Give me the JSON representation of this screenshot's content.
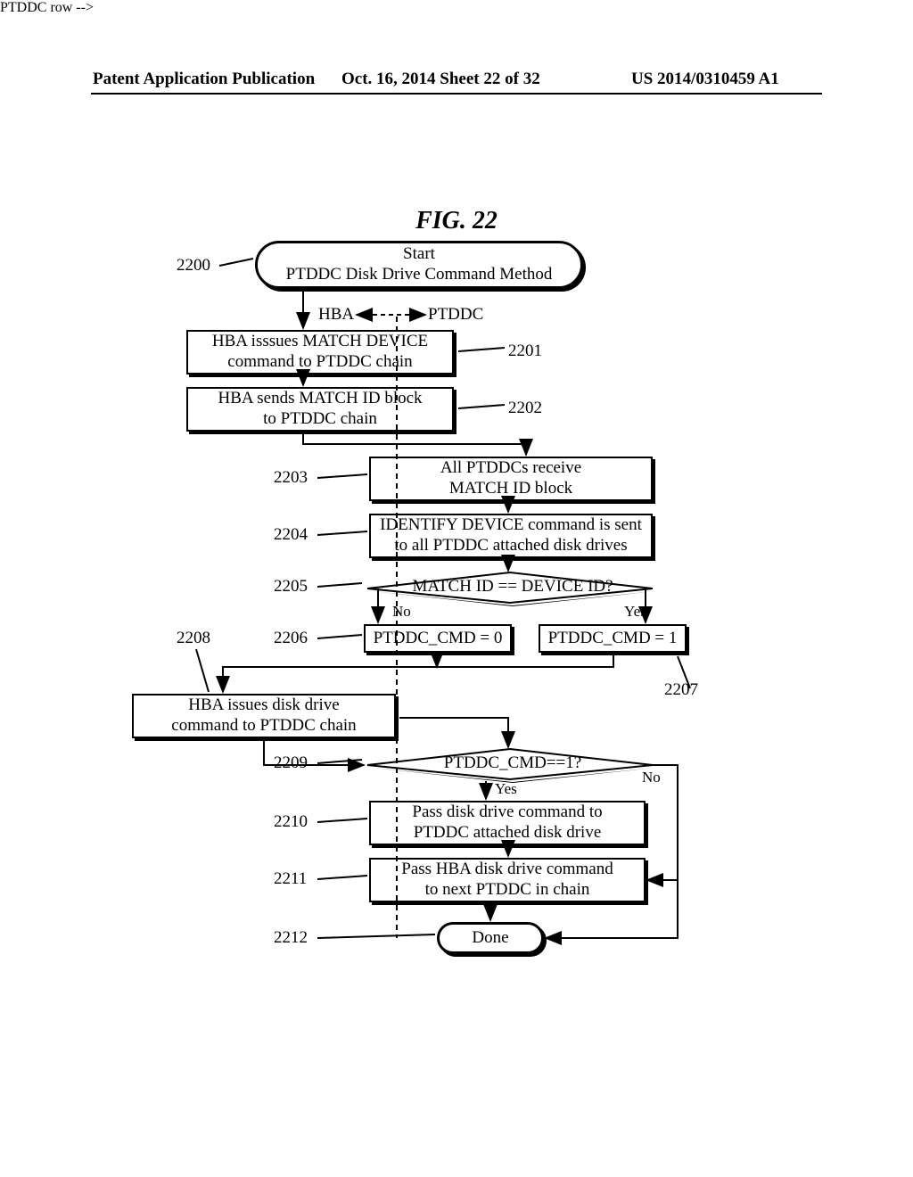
{
  "header": {
    "left": "Patent Application Publication",
    "mid": "Oct. 16, 2014  Sheet 22 of 32",
    "right": "US 2014/0310459 A1"
  },
  "figure_label": "FIG. 22",
  "hba_ptddc": {
    "hba": "HBA",
    "ptddc": "PTDDC"
  },
  "ref": {
    "r2200": "2200",
    "r2201": "2201",
    "r2202": "2202",
    "r2203": "2203",
    "r2204": "2204",
    "r2205": "2205",
    "r2206": "2206",
    "r2207": "2207",
    "r2208": "2208",
    "r2209": "2209",
    "r2210": "2210",
    "r2211": "2211",
    "r2212": "2212"
  },
  "steps": {
    "start_l1": "Start",
    "start_l2": "PTDDC Disk Drive Command Method",
    "s2201_l1": "HBA isssues MATCH DEVICE",
    "s2201_l2": "command to PTDDC chain",
    "s2202_l1": "HBA sends MATCH ID block",
    "s2202_l2": "to PTDDC chain",
    "s2203_l1": "All PTDDCs receive",
    "s2203_l2": "MATCH ID block",
    "s2204_l1": "IDENTIFY DEVICE command is sent",
    "s2204_l2": "to all PTDDC attached disk drives",
    "d2205": "MATCH ID == DEVICE ID?",
    "s2206": "PTDDC_CMD = 0",
    "s2207": "PTDDC_CMD = 1",
    "s2208_l1": "HBA issues disk drive",
    "s2208_l2": "command to PTDDC chain",
    "d2209": "PTDDC_CMD==1?",
    "s2210_l1": "Pass disk drive command to",
    "s2210_l2": "PTDDC attached disk drive",
    "s2211_l1": "Pass HBA disk drive command",
    "s2211_l2": "to next PTDDC in chain",
    "done": "Done"
  },
  "branch": {
    "yes": "Yes",
    "no": "No"
  },
  "chart_data": {
    "type": "flowchart",
    "title": "FIG. 22 — PTDDC Disk Drive Command Method",
    "lanes": [
      "HBA",
      "PTDDC"
    ],
    "nodes": [
      {
        "id": "2200",
        "type": "terminator",
        "lane": "both",
        "text": "Start — PTDDC Disk Drive Command Method"
      },
      {
        "id": "2201",
        "type": "process",
        "lane": "HBA",
        "text": "HBA issues MATCH DEVICE command to PTDDC chain"
      },
      {
        "id": "2202",
        "type": "process",
        "lane": "HBA",
        "text": "HBA sends MATCH ID block to PTDDC chain"
      },
      {
        "id": "2203",
        "type": "process",
        "lane": "PTDDC",
        "text": "All PTDDCs receive MATCH ID block"
      },
      {
        "id": "2204",
        "type": "process",
        "lane": "PTDDC",
        "text": "IDENTIFY DEVICE command is sent to all PTDDC attached disk drives"
      },
      {
        "id": "2205",
        "type": "decision",
        "lane": "PTDDC",
        "text": "MATCH ID == DEVICE ID?"
      },
      {
        "id": "2206",
        "type": "process",
        "lane": "PTDDC",
        "text": "PTDDC_CMD = 0"
      },
      {
        "id": "2207",
        "type": "process",
        "lane": "PTDDC",
        "text": "PTDDC_CMD = 1"
      },
      {
        "id": "2208",
        "type": "process",
        "lane": "HBA",
        "text": "HBA issues disk drive command to PTDDC chain"
      },
      {
        "id": "2209",
        "type": "decision",
        "lane": "PTDDC",
        "text": "PTDDC_CMD == 1?"
      },
      {
        "id": "2210",
        "type": "process",
        "lane": "PTDDC",
        "text": "Pass disk drive command to PTDDC attached disk drive"
      },
      {
        "id": "2211",
        "type": "process",
        "lane": "PTDDC",
        "text": "Pass HBA disk drive command to next PTDDC in chain"
      },
      {
        "id": "2212",
        "type": "terminator",
        "lane": "both",
        "text": "Done"
      }
    ],
    "edges": [
      {
        "from": "2200",
        "to": "2201"
      },
      {
        "from": "2201",
        "to": "2202"
      },
      {
        "from": "2202",
        "to": "2203"
      },
      {
        "from": "2203",
        "to": "2204"
      },
      {
        "from": "2204",
        "to": "2205"
      },
      {
        "from": "2205",
        "to": "2206",
        "label": "No"
      },
      {
        "from": "2205",
        "to": "2207",
        "label": "Yes"
      },
      {
        "from": "2206",
        "to": "2208"
      },
      {
        "from": "2207",
        "to": "2208"
      },
      {
        "from": "2208",
        "to": "2209"
      },
      {
        "from": "2209",
        "to": "2210",
        "label": "Yes"
      },
      {
        "from": "2209",
        "to": "2211",
        "label": "No",
        "note": "No branch bypasses 2210 and routes to 2211"
      },
      {
        "from": "2210",
        "to": "2211"
      },
      {
        "from": "2211",
        "to": "2212"
      }
    ]
  }
}
